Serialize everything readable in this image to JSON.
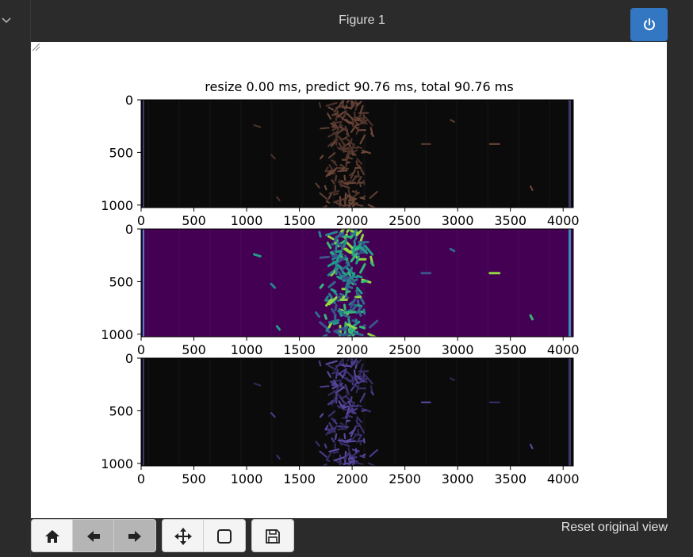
{
  "window": {
    "title": "Figure 1"
  },
  "icons": {
    "collapse": "chevron-down-icon",
    "power": "power-icon",
    "home": "home-icon",
    "back": "arrow-left-icon",
    "forward": "arrow-right-icon",
    "pan": "move-icon",
    "zoom": "zoom-rect-icon",
    "save": "save-icon"
  },
  "status": {
    "reset_label": "Reset original view"
  },
  "colors": {
    "accent": "#3377c2",
    "viridis_bg": "#440154",
    "dark_bg": "#0b0b0b"
  },
  "chart_data": {
    "type": "heatmap",
    "title": "resize 0.00 ms, predict 90.76 ms, total 90.76 ms",
    "panels": [
      {
        "name": "",
        "colormap": "grayscale-rgb"
      },
      {
        "name": "",
        "colormap": "viridis"
      },
      {
        "name": "",
        "colormap": "overlay"
      }
    ],
    "x_ticks": [
      "0",
      "500",
      "1000",
      "1500",
      "2000",
      "2500",
      "3000",
      "3500",
      "4000"
    ],
    "y_ticks": [
      "0",
      "500",
      "1000"
    ],
    "xlim": [
      0,
      4096
    ],
    "ylim": [
      1024,
      0
    ]
  }
}
